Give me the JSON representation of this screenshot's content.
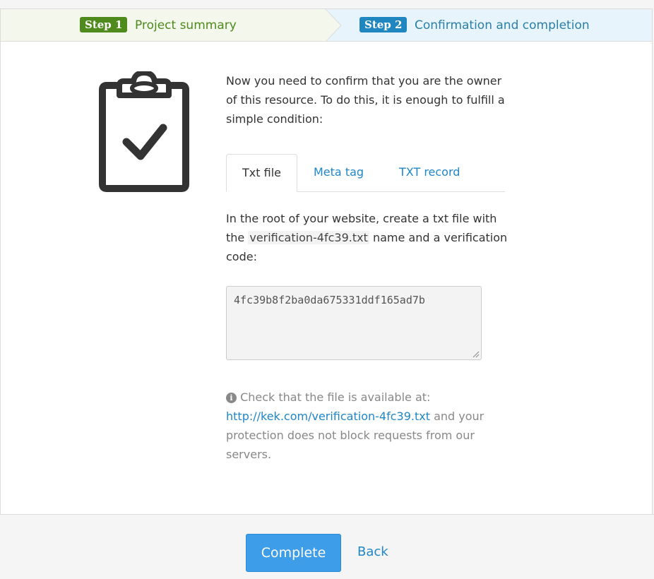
{
  "steps": [
    {
      "badge": "Step 1",
      "label": "Project summary"
    },
    {
      "badge": "Step 2",
      "label": "Confirmation and completion"
    }
  ],
  "intro": "Now you need to confirm that you are the owner of this resource. To do this, it is enough to fulfill a simple condition:",
  "tabs": [
    {
      "label": "Txt file",
      "active": true
    },
    {
      "label": "Meta tag",
      "active": false
    },
    {
      "label": "TXT record",
      "active": false
    }
  ],
  "instruction": {
    "before": "In the root of your website, create a txt file with the ",
    "filename": "verification-4fc39.txt",
    "after": " name and a verification code:"
  },
  "verification_code": "4fc39b8f2ba0da675331ddf165ad7b",
  "hint": {
    "icon": "info-circle-icon",
    "before": " Check that the file is available at: ",
    "link": "http://kek.com/verification-4fc39.txt",
    "after": " and your protection does not block requests from our servers."
  },
  "footer": {
    "complete_label": "Complete",
    "back_label": "Back"
  },
  "colors": {
    "step1_green": "#4e8a1c",
    "step2_blue": "#1f86bf",
    "link_blue": "#1f86c9",
    "button_blue": "#3d9de8"
  }
}
